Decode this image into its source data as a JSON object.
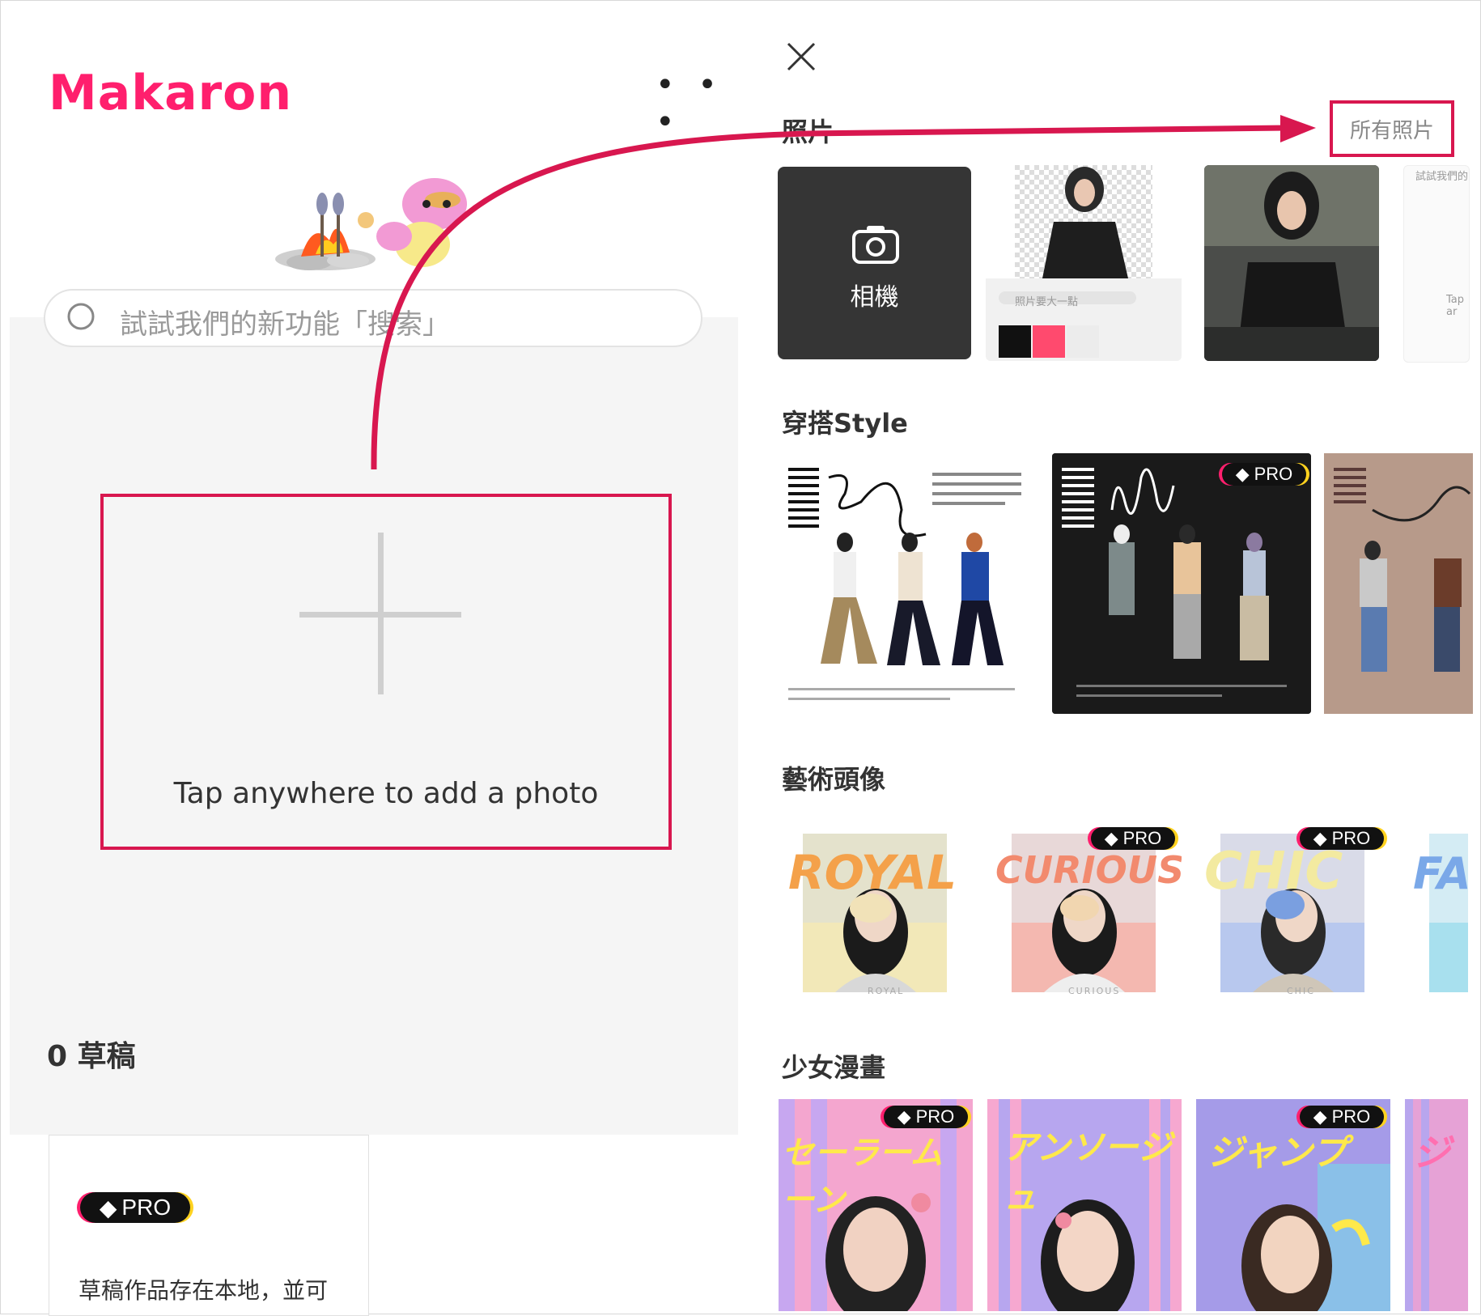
{
  "app": {
    "logo": "Makaron",
    "more_label": "• • •"
  },
  "search": {
    "placeholder": "試試我們的新功能「搜索」"
  },
  "editor": {
    "add_photo_hint": "Tap anywhere to add a photo"
  },
  "drafts": {
    "title": "0 草稿",
    "pro_label": "PRO",
    "note": "草稿作品存在本地，並可"
  },
  "photos": {
    "section_title": "照片",
    "all_photos_label": "所有照片",
    "camera_label": "相機",
    "thumb_search_text": "照片要大一點",
    "thumb_peek_text": "試試我們的",
    "thumb_peek_tap": "Tap ar"
  },
  "outfit": {
    "section_title": "穿搭Style",
    "pro_label": "PRO"
  },
  "art_avatar": {
    "section_title": "藝術頭像",
    "cards": [
      {
        "headline": "ROYAL",
        "caption": "ROYAL",
        "pro": false
      },
      {
        "headline": "CURIOUS",
        "caption": "CURIOUS",
        "pro": true,
        "pro_label": "PRO"
      },
      {
        "headline": "CHIC",
        "caption": "CHIC",
        "pro": true,
        "pro_label": "PRO"
      },
      {
        "headline": "FA",
        "caption": "",
        "pro": false
      }
    ]
  },
  "manga": {
    "section_title": "少女漫畫",
    "cards": [
      {
        "headline": "セーラームーン",
        "pro": true,
        "pro_label": "PRO"
      },
      {
        "headline": "アンソージュ",
        "pro": false
      },
      {
        "headline": "ジャンプ",
        "pro": true,
        "pro_label": "PRO"
      },
      {
        "headline": "ジ",
        "pro": false
      }
    ]
  },
  "colors": {
    "brand": "#ff1f6d",
    "highlight": "#d8174f",
    "arrow": "#d8174f"
  }
}
